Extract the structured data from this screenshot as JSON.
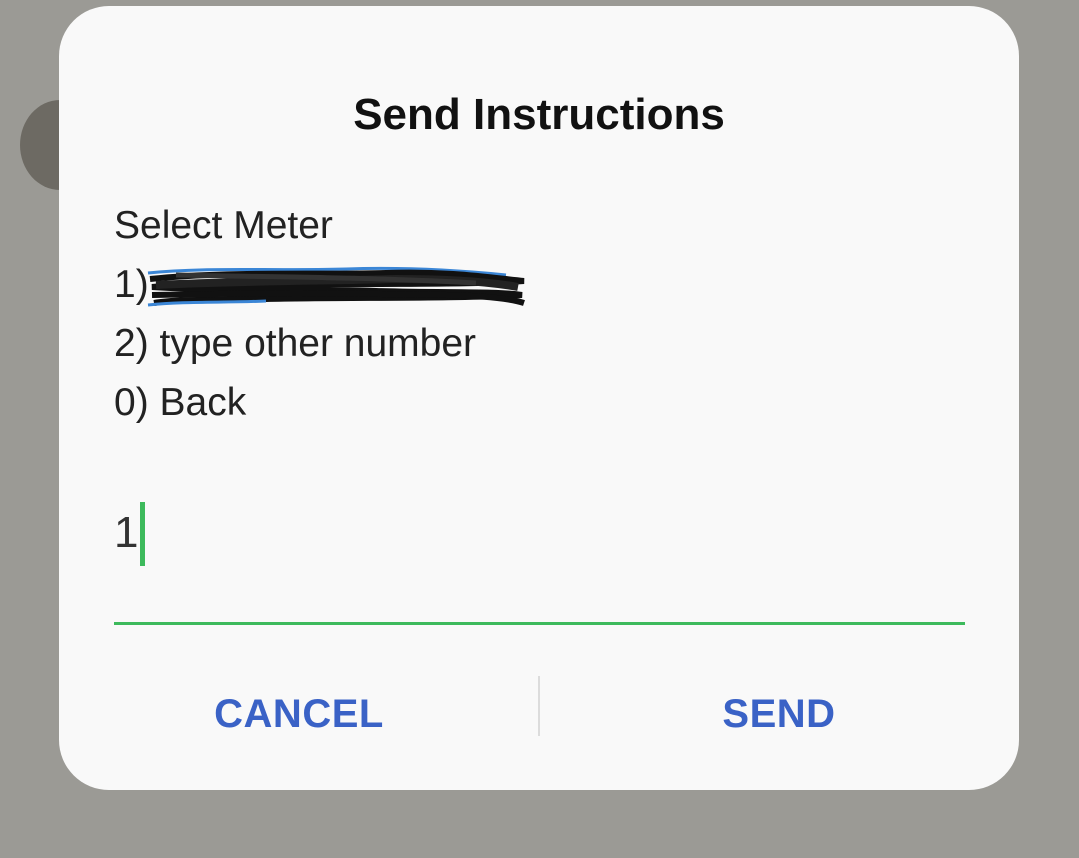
{
  "dialog": {
    "title": "Send Instructions",
    "message_lines": [
      "Select Meter",
      "1)",
      "2) type other number",
      "0) Back"
    ],
    "input": {
      "value": "1"
    },
    "buttons": {
      "cancel": "CANCEL",
      "send": "SEND"
    }
  },
  "colors": {
    "accent_green": "#3dba5c",
    "button_blue": "#3a62c6",
    "scrim": "#9b9a95",
    "dialog_bg": "#f9f9f9"
  }
}
